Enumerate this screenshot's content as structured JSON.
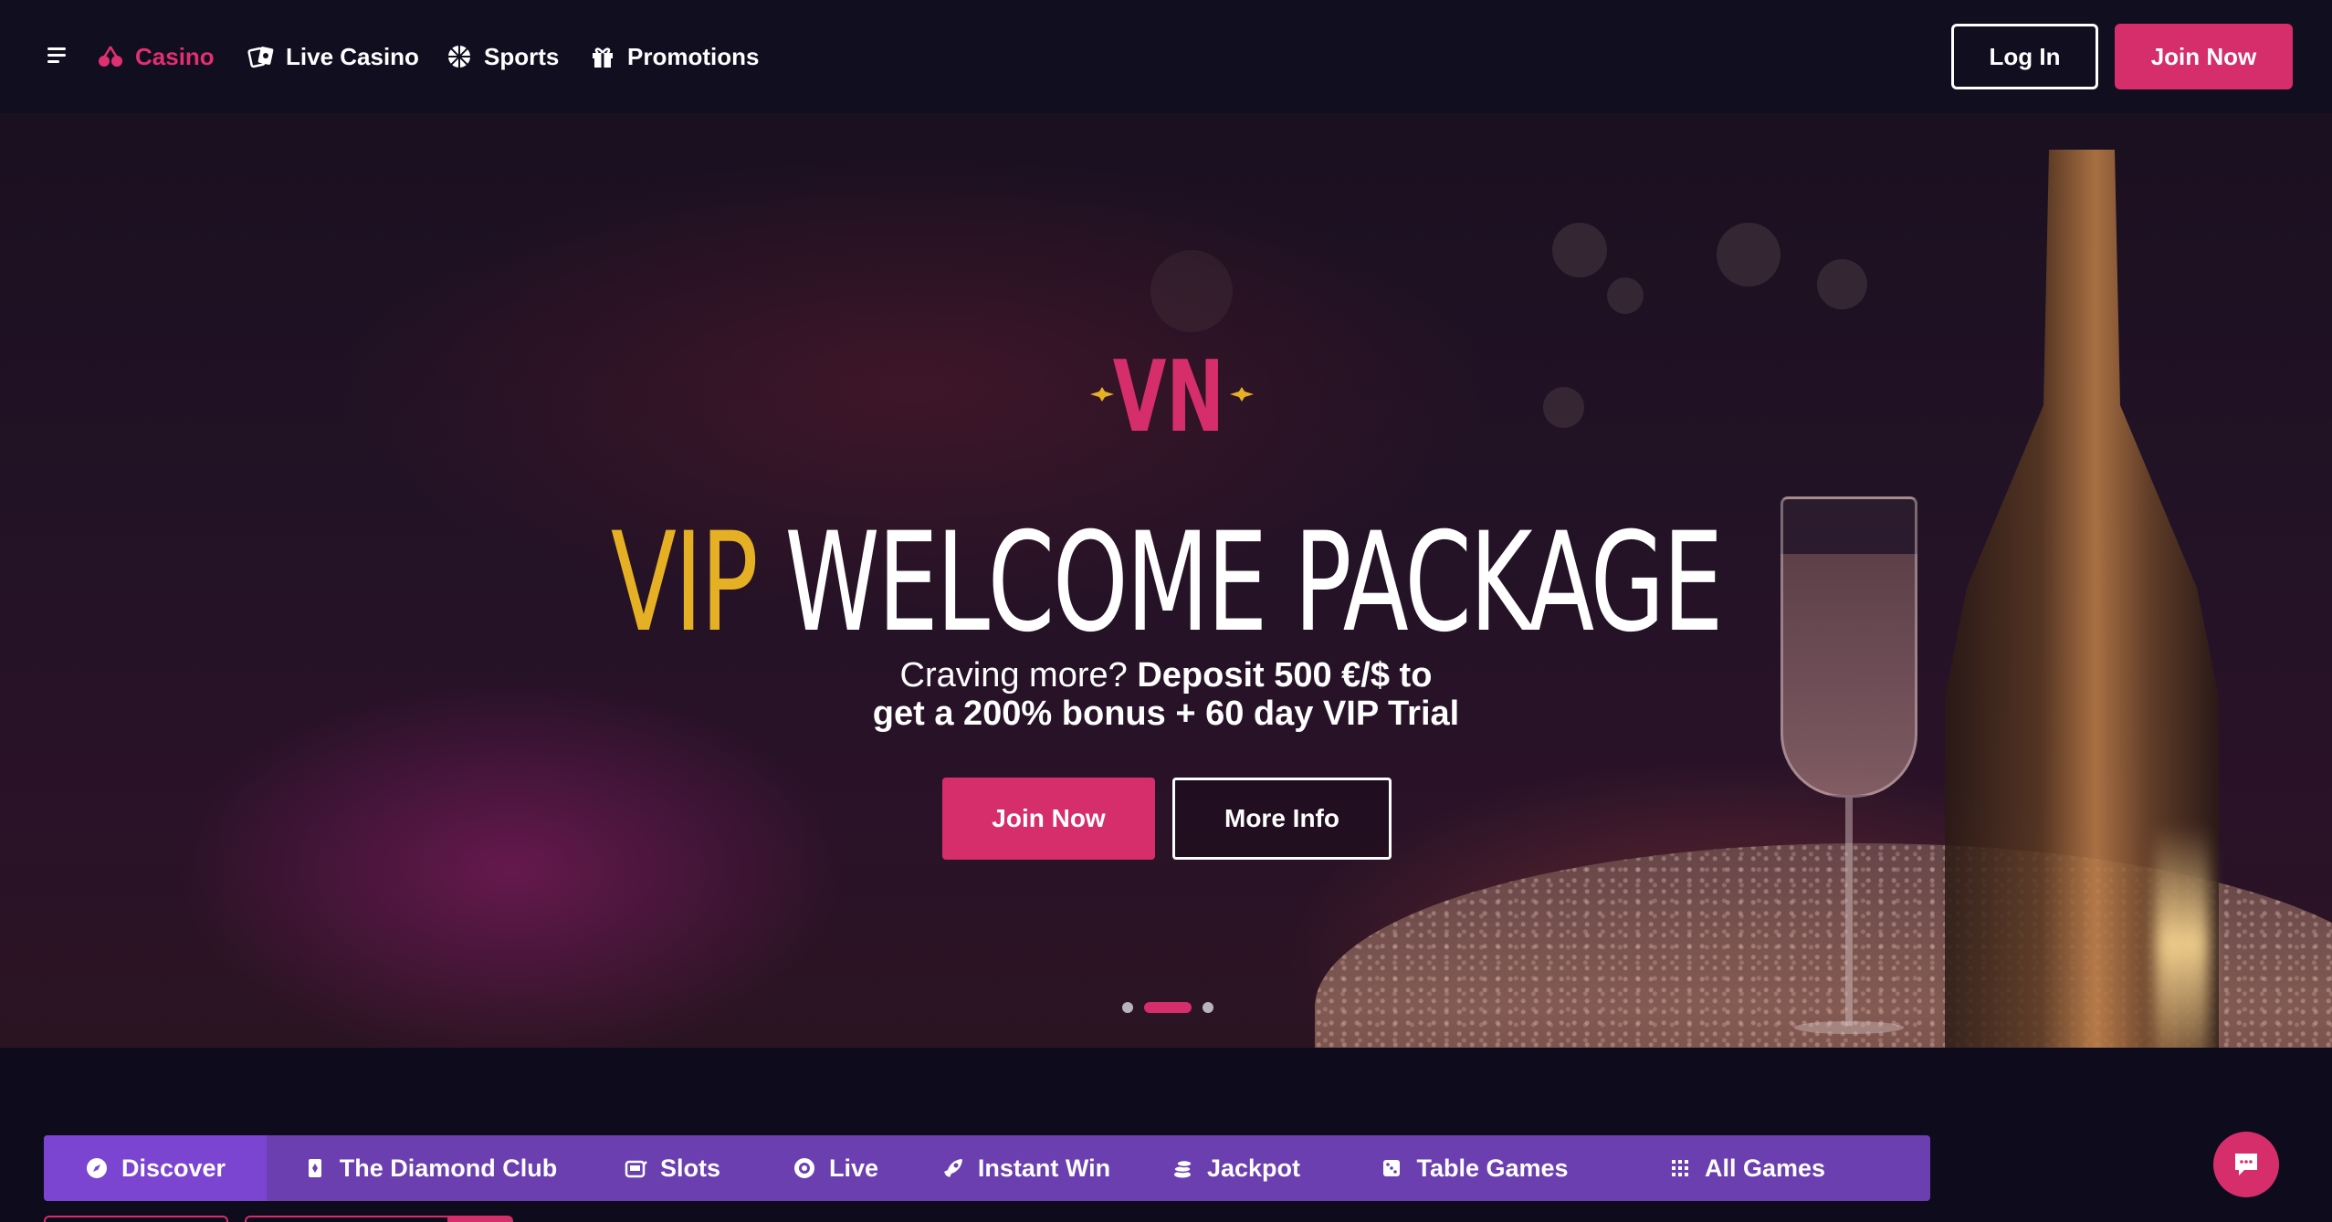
{
  "header": {
    "nav": [
      {
        "label": "Casino",
        "icon": "cherries-icon",
        "active": true
      },
      {
        "label": "Live Casino",
        "icon": "cards-icon",
        "active": false
      },
      {
        "label": "Sports",
        "icon": "ball-icon",
        "active": false
      },
      {
        "label": "Promotions",
        "icon": "gift-icon",
        "active": false
      }
    ],
    "login_label": "Log In",
    "join_label": "Join Now"
  },
  "hero": {
    "logo_text": "VN",
    "headline_accent": "VIP",
    "headline_rest": "WELCOME PACKAGE",
    "sub_line1_plain": "Craving more? ",
    "sub_line1_bold": "Deposit 500 €/$ to",
    "sub_line2_bold": "get a 200% bonus + 60 day VIP Trial",
    "join_label": "Join Now",
    "more_label": "More Info",
    "slides_total": 3,
    "slide_active": 2
  },
  "categories": [
    {
      "label": "Discover",
      "icon": "compass-icon",
      "active": true
    },
    {
      "label": "The Diamond Club",
      "icon": "card-icon",
      "active": false
    },
    {
      "label": "Slots",
      "icon": "slot-machine-icon",
      "active": false
    },
    {
      "label": "Live",
      "icon": "chip-icon",
      "active": false
    },
    {
      "label": "Instant Win",
      "icon": "rocket-icon",
      "active": false
    },
    {
      "label": "Jackpot",
      "icon": "coins-icon",
      "active": false
    },
    {
      "label": "Table Games",
      "icon": "dice-icon",
      "active": false
    },
    {
      "label": "All Games",
      "icon": "grid-icon",
      "active": false
    }
  ],
  "colors": {
    "brand_pink": "#d62e6b",
    "accent_gold": "#e6b025",
    "tab_purple": "#6b3fb0",
    "background": "#0e0c1c"
  }
}
